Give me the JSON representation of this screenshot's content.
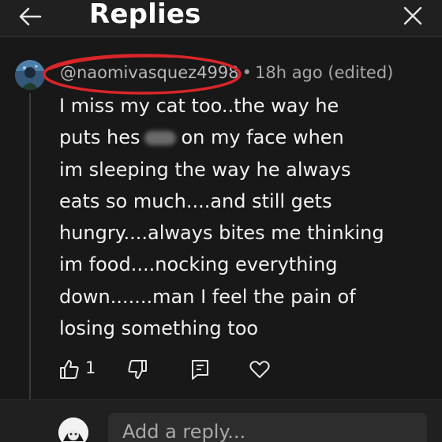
{
  "header": {
    "title": "Replies",
    "back_icon": "arrow-left-icon",
    "close_icon": "close-icon"
  },
  "comment": {
    "username": "@naomivasquez4998",
    "separator": "•",
    "timestamp": "18h ago (edited)",
    "body_lines": [
      "I miss my cat too..the way he",
      "puts hes",
      "on my face when",
      "im sleeping the way he always",
      "eats so much....and still gets",
      "hungry....always bites me thinking",
      "im food....nocking everything",
      "down.......man I feel the pain of",
      "losing something too"
    ],
    "like_count": "1",
    "annotation_color": "#d9262a"
  },
  "actions": {
    "like_icon": "thumbs-up-icon",
    "dislike_icon": "thumbs-down-icon",
    "reply_icon": "comment-icon",
    "heart_icon": "heart-icon"
  },
  "reply_bar": {
    "placeholder": "Add a reply..."
  },
  "colors": {
    "background": "#181818",
    "text": "#f1f1f1",
    "muted": "#a8a8a8",
    "annotation": "#d9262a"
  }
}
